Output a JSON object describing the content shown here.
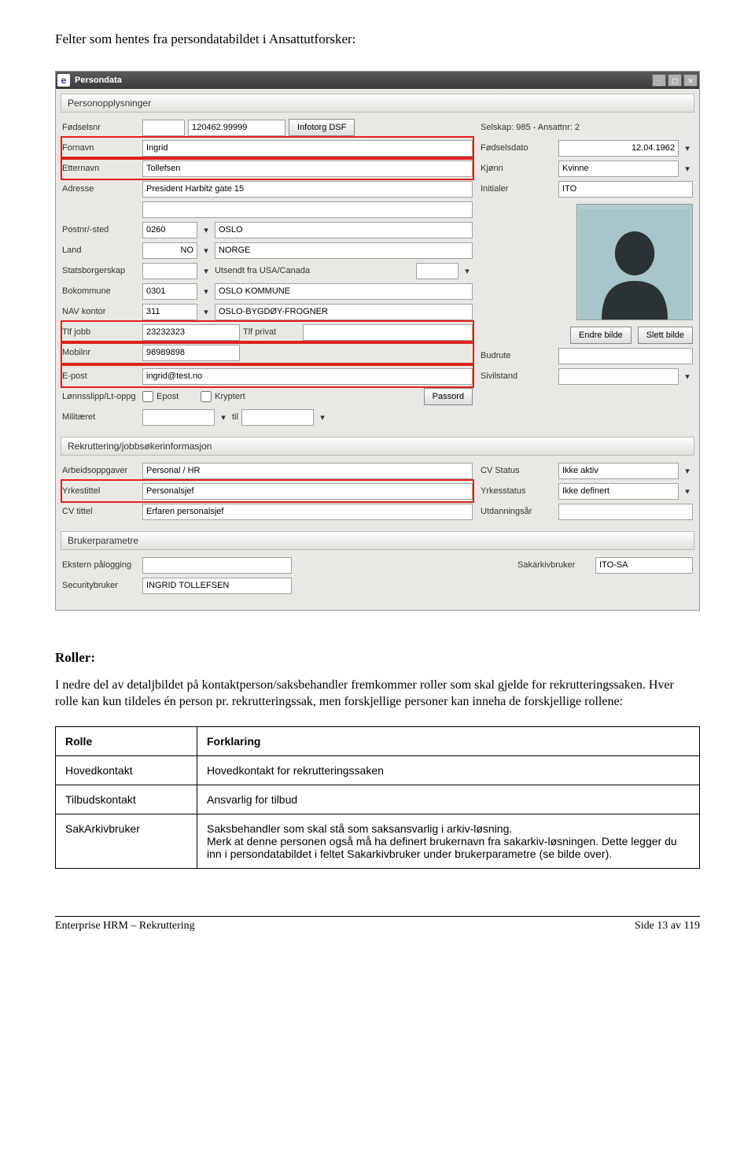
{
  "heading": "Felter som hentes fra persondatabildet i Ansattutforsker:",
  "win": {
    "title": "Persondata",
    "sections": {
      "person": "Personopplysninger",
      "rekr": "Rekruttering/jobbsøkerinformasjon",
      "bruker": "Brukerparametre"
    },
    "labels": {
      "fodselsnr": "Fødselsnr",
      "fornavn": "Fornavn",
      "etternavn": "Etternavn",
      "adresse": "Adresse",
      "postnr": "Postnr/-sted",
      "land": "Land",
      "stats": "Statsborgerskap",
      "bokom": "Bokommune",
      "nav": "NAV kontor",
      "tlf_jobb": "Tlf jobb",
      "tlf_privat": "Tlf privat",
      "mobil": "Mobilnr",
      "epost": "E-post",
      "lonnslipp": "Lønnsslipp/Lt-oppg",
      "epost_cb": "Epost",
      "kryptert_cb": "Kryptert",
      "passord_btn": "Passord",
      "militar": "Militæret",
      "til": "til",
      "selskap": "Selskap: 985 - Ansattnr:  2",
      "fodselsdato": "Fødselsdato",
      "kjonn": "Kjønn",
      "initialer": "Initialer",
      "endre_bilde": "Endre bilde",
      "slett_bilde": "Slett bilde",
      "budrute": "Budrute",
      "sivilstand": "Sivilstand",
      "infotorg": "Infotorg DSF",
      "utsendt": "Utsendt fra USA/Canada",
      "arb": "Arbeidsoppgaver",
      "yrk": "Yrkestittel",
      "cvt": "CV tittel",
      "cvs": "CV Status",
      "yrks": "Yrkesstatus",
      "utd": "Utdanningsår",
      "ekst": "Ekstern pålogging",
      "sec": "Securitybruker",
      "sak": "Sakarkivbruker"
    },
    "values": {
      "fodselsnr_a": "",
      "fodselsnr_b": "120462.99999",
      "fornavn": "Ingrid",
      "etternavn": "Tollefsen",
      "adresse": "President Harbitz gate 15",
      "adresse2": "",
      "postnr": "0260",
      "poststed": "OSLO",
      "land": "NO",
      "land_navn": "NORGE",
      "stats": "",
      "utsendt_val": "",
      "bokom": "0301",
      "bokom_navn": "OSLO KOMMUNE",
      "nav": "311",
      "nav_navn": "OSLO-BYGDØY-FROGNER",
      "tlf_jobb": "23232323",
      "tlf_privat": "",
      "mobil": "98989898",
      "epost": "ingrid@test.no",
      "mil_fra": "",
      "mil_til": "",
      "fodselsdato": "12.04.1962",
      "kjonn": "Kvinne",
      "initialer": "ITO",
      "budrute": "",
      "sivilstand": "",
      "arb": "Personal / HR",
      "yrk": "Personalsjef",
      "cvt": "Erfaren personalsjef",
      "cvs": "Ikke aktiv",
      "yrks": "Ikke definert",
      "utd": "",
      "ekst": "",
      "sec": "INGRID TOLLEFSEN",
      "sak": "ITO-SA"
    }
  },
  "roller": {
    "title": "Roller:",
    "text": "I nedre del av detaljbildet på kontaktperson/saksbehandler fremkommer roller som skal gjelde for rekrutteringssaken. Hver rolle kan kun tildeles én person pr. rekrutteringssak, men forskjellige personer kan inneha de forskjellige rollene:"
  },
  "table": {
    "h1": "Rolle",
    "h2": "Forklaring",
    "rows": [
      {
        "r": "Hovedkontakt",
        "f": "Hovedkontakt for rekrutteringssaken"
      },
      {
        "r": "Tilbudskontakt",
        "f": "Ansvarlig for tilbud"
      },
      {
        "r": "SakArkivbruker",
        "f": "Saksbehandler som skal stå som saksansvarlig i arkiv-løsning.\nMerk at denne personen også må ha definert brukernavn fra sakarkiv-løsningen. Dette legger du inn i persondatabildet i feltet Sakarkivbruker under brukerparametre (se bilde over)."
      }
    ]
  },
  "footer": {
    "left": "Enterprise HRM – Rekruttering",
    "right": "Side 13 av 119"
  }
}
